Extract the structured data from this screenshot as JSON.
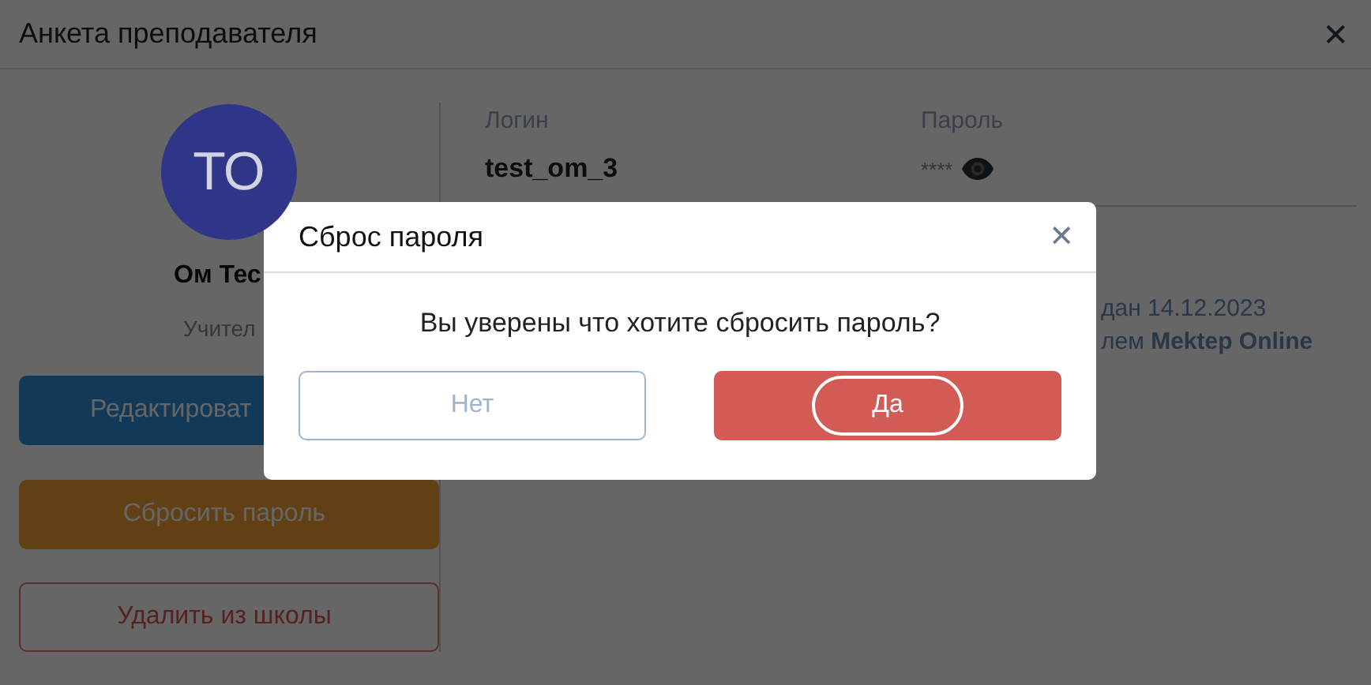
{
  "window": {
    "title": "Анкета преподавателя",
    "close": "✕"
  },
  "profile": {
    "initials": "ТО",
    "name": "Ом Тес",
    "role": "Учител"
  },
  "actions": [
    {
      "label": "Редактироват",
      "kind": "primary"
    },
    {
      "label": "Сбросить пароль",
      "kind": "warning"
    },
    {
      "label": "Удалить из школы",
      "kind": "danger"
    }
  ],
  "fields": [
    {
      "label": "Логин",
      "value": "test_om_3",
      "kind": "text"
    },
    {
      "label": "Пароль",
      "value": "****",
      "kind": "secret"
    }
  ],
  "notes": [
    "дан 14.12.2023",
    "лем **Mektep Online**"
  ],
  "dialog": {
    "title": "Сброс пароля",
    "close": "✕",
    "message": "Вы уверены что хотите сбросить пароль?",
    "buttons": [
      {
        "label": "Нет",
        "kind": "cancel",
        "focused": false
      },
      {
        "label": "Да",
        "kind": "confirm",
        "focused": true
      }
    ]
  }
}
